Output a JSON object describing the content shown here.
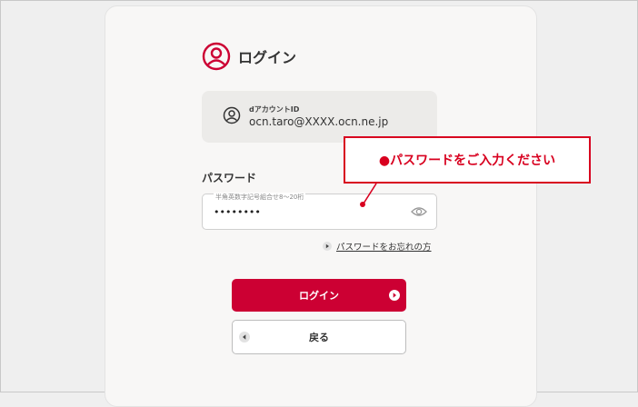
{
  "header": {
    "title": "ログイン",
    "icon": "user-circle-icon"
  },
  "account": {
    "label": "dアカウントID",
    "value": "ocn.taro@XXXX.ocn.ne.jp",
    "icon": "user-circle-icon"
  },
  "password": {
    "label": "パスワード",
    "placeholder": "半角英数字記号組合せ8〜20桁",
    "value": "••••••••",
    "toggle_icon": "eye-icon"
  },
  "forgot_link": {
    "text": "パスワードをお忘れの方",
    "icon": "play-circle-icon"
  },
  "buttons": {
    "login": "ログイン",
    "back": "戻る"
  },
  "callout": {
    "text": "●パスワードをご入力ください"
  },
  "colors": {
    "accent": "#cc0033",
    "callout": "#d8001f"
  }
}
